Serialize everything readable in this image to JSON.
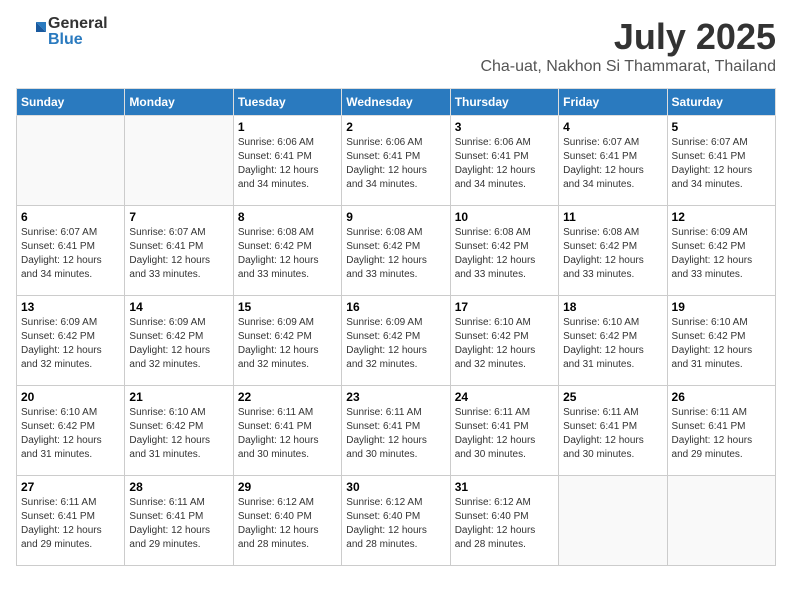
{
  "logo": {
    "general": "General",
    "blue": "Blue"
  },
  "title": {
    "month_year": "July 2025",
    "location": "Cha-uat, Nakhon Si Thammarat, Thailand"
  },
  "weekdays": [
    "Sunday",
    "Monday",
    "Tuesday",
    "Wednesday",
    "Thursday",
    "Friday",
    "Saturday"
  ],
  "weeks": [
    [
      {
        "day": "",
        "sunrise": "",
        "sunset": "",
        "daylight": ""
      },
      {
        "day": "",
        "sunrise": "",
        "sunset": "",
        "daylight": ""
      },
      {
        "day": "1",
        "sunrise": "Sunrise: 6:06 AM",
        "sunset": "Sunset: 6:41 PM",
        "daylight": "Daylight: 12 hours and 34 minutes."
      },
      {
        "day": "2",
        "sunrise": "Sunrise: 6:06 AM",
        "sunset": "Sunset: 6:41 PM",
        "daylight": "Daylight: 12 hours and 34 minutes."
      },
      {
        "day": "3",
        "sunrise": "Sunrise: 6:06 AM",
        "sunset": "Sunset: 6:41 PM",
        "daylight": "Daylight: 12 hours and 34 minutes."
      },
      {
        "day": "4",
        "sunrise": "Sunrise: 6:07 AM",
        "sunset": "Sunset: 6:41 PM",
        "daylight": "Daylight: 12 hours and 34 minutes."
      },
      {
        "day": "5",
        "sunrise": "Sunrise: 6:07 AM",
        "sunset": "Sunset: 6:41 PM",
        "daylight": "Daylight: 12 hours and 34 minutes."
      }
    ],
    [
      {
        "day": "6",
        "sunrise": "Sunrise: 6:07 AM",
        "sunset": "Sunset: 6:41 PM",
        "daylight": "Daylight: 12 hours and 34 minutes."
      },
      {
        "day": "7",
        "sunrise": "Sunrise: 6:07 AM",
        "sunset": "Sunset: 6:41 PM",
        "daylight": "Daylight: 12 hours and 33 minutes."
      },
      {
        "day": "8",
        "sunrise": "Sunrise: 6:08 AM",
        "sunset": "Sunset: 6:42 PM",
        "daylight": "Daylight: 12 hours and 33 minutes."
      },
      {
        "day": "9",
        "sunrise": "Sunrise: 6:08 AM",
        "sunset": "Sunset: 6:42 PM",
        "daylight": "Daylight: 12 hours and 33 minutes."
      },
      {
        "day": "10",
        "sunrise": "Sunrise: 6:08 AM",
        "sunset": "Sunset: 6:42 PM",
        "daylight": "Daylight: 12 hours and 33 minutes."
      },
      {
        "day": "11",
        "sunrise": "Sunrise: 6:08 AM",
        "sunset": "Sunset: 6:42 PM",
        "daylight": "Daylight: 12 hours and 33 minutes."
      },
      {
        "day": "12",
        "sunrise": "Sunrise: 6:09 AM",
        "sunset": "Sunset: 6:42 PM",
        "daylight": "Daylight: 12 hours and 33 minutes."
      }
    ],
    [
      {
        "day": "13",
        "sunrise": "Sunrise: 6:09 AM",
        "sunset": "Sunset: 6:42 PM",
        "daylight": "Daylight: 12 hours and 32 minutes."
      },
      {
        "day": "14",
        "sunrise": "Sunrise: 6:09 AM",
        "sunset": "Sunset: 6:42 PM",
        "daylight": "Daylight: 12 hours and 32 minutes."
      },
      {
        "day": "15",
        "sunrise": "Sunrise: 6:09 AM",
        "sunset": "Sunset: 6:42 PM",
        "daylight": "Daylight: 12 hours and 32 minutes."
      },
      {
        "day": "16",
        "sunrise": "Sunrise: 6:09 AM",
        "sunset": "Sunset: 6:42 PM",
        "daylight": "Daylight: 12 hours and 32 minutes."
      },
      {
        "day": "17",
        "sunrise": "Sunrise: 6:10 AM",
        "sunset": "Sunset: 6:42 PM",
        "daylight": "Daylight: 12 hours and 32 minutes."
      },
      {
        "day": "18",
        "sunrise": "Sunrise: 6:10 AM",
        "sunset": "Sunset: 6:42 PM",
        "daylight": "Daylight: 12 hours and 31 minutes."
      },
      {
        "day": "19",
        "sunrise": "Sunrise: 6:10 AM",
        "sunset": "Sunset: 6:42 PM",
        "daylight": "Daylight: 12 hours and 31 minutes."
      }
    ],
    [
      {
        "day": "20",
        "sunrise": "Sunrise: 6:10 AM",
        "sunset": "Sunset: 6:42 PM",
        "daylight": "Daylight: 12 hours and 31 minutes."
      },
      {
        "day": "21",
        "sunrise": "Sunrise: 6:10 AM",
        "sunset": "Sunset: 6:42 PM",
        "daylight": "Daylight: 12 hours and 31 minutes."
      },
      {
        "day": "22",
        "sunrise": "Sunrise: 6:11 AM",
        "sunset": "Sunset: 6:41 PM",
        "daylight": "Daylight: 12 hours and 30 minutes."
      },
      {
        "day": "23",
        "sunrise": "Sunrise: 6:11 AM",
        "sunset": "Sunset: 6:41 PM",
        "daylight": "Daylight: 12 hours and 30 minutes."
      },
      {
        "day": "24",
        "sunrise": "Sunrise: 6:11 AM",
        "sunset": "Sunset: 6:41 PM",
        "daylight": "Daylight: 12 hours and 30 minutes."
      },
      {
        "day": "25",
        "sunrise": "Sunrise: 6:11 AM",
        "sunset": "Sunset: 6:41 PM",
        "daylight": "Daylight: 12 hours and 30 minutes."
      },
      {
        "day": "26",
        "sunrise": "Sunrise: 6:11 AM",
        "sunset": "Sunset: 6:41 PM",
        "daylight": "Daylight: 12 hours and 29 minutes."
      }
    ],
    [
      {
        "day": "27",
        "sunrise": "Sunrise: 6:11 AM",
        "sunset": "Sunset: 6:41 PM",
        "daylight": "Daylight: 12 hours and 29 minutes."
      },
      {
        "day": "28",
        "sunrise": "Sunrise: 6:11 AM",
        "sunset": "Sunset: 6:41 PM",
        "daylight": "Daylight: 12 hours and 29 minutes."
      },
      {
        "day": "29",
        "sunrise": "Sunrise: 6:12 AM",
        "sunset": "Sunset: 6:40 PM",
        "daylight": "Daylight: 12 hours and 28 minutes."
      },
      {
        "day": "30",
        "sunrise": "Sunrise: 6:12 AM",
        "sunset": "Sunset: 6:40 PM",
        "daylight": "Daylight: 12 hours and 28 minutes."
      },
      {
        "day": "31",
        "sunrise": "Sunrise: 6:12 AM",
        "sunset": "Sunset: 6:40 PM",
        "daylight": "Daylight: 12 hours and 28 minutes."
      },
      {
        "day": "",
        "sunrise": "",
        "sunset": "",
        "daylight": ""
      },
      {
        "day": "",
        "sunrise": "",
        "sunset": "",
        "daylight": ""
      }
    ]
  ]
}
